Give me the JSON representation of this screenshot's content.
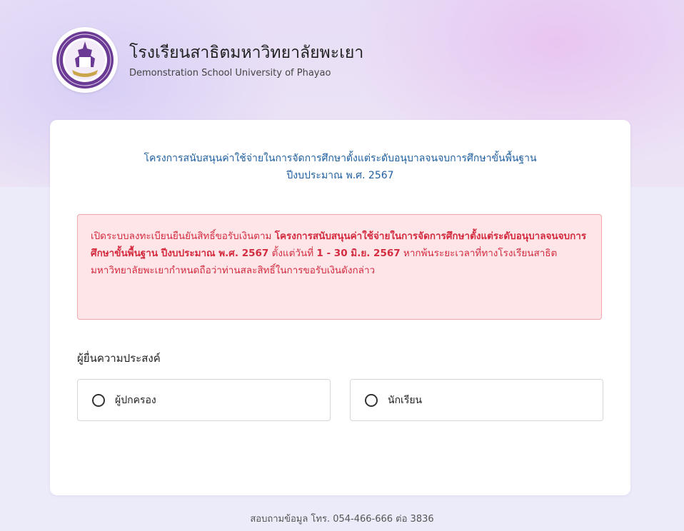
{
  "header": {
    "school_name_th": "โรงเรียนสาธิตมหาวิทยาลัยพะเยา",
    "school_name_en": "Demonstration School University of Phayao",
    "logo_icon": "school-emblem-icon"
  },
  "card": {
    "project_title_line1": "โครงการสนับสนุนค่าใช้จ่ายในการจัดการศึกษาตั้งแต่ระดับอนุบาลจนจบการศึกษาขั้นพื้นฐาน",
    "project_title_line2": "ปีงบประมาณ พ.ศ. 2567",
    "notice": {
      "intro": "เปิดระบบลงทะเบียนยืนยันสิทธิ์ขอรับเงินตาม ",
      "project_name": "โครงการสนับสนุนค่าใช้จ่ายในการจัดการศึกษาตั้งแต่ระดับอนุบาลจนจบการศึกษาขั้นพื้นฐาน ปีงบประมาณ พ.ศ. 2567",
      "date_prefix": "  ตั้งแต่วันที่ ",
      "date_range": "1 - 30 มิ.ย. 2567",
      "outro": " หากพ้นระยะเวลาที่ทางโรงเรียนสาธิตมหาวิทยาลัยพะเยากำหนดถือว่าท่านสละสิทธิ์ในการขอรับเงินดังกล่าว"
    },
    "applicant_label": "ผู้ยื่นความประสงค์",
    "options": [
      {
        "label": "ผู้ปกครอง",
        "selected": false
      },
      {
        "label": "นักเรียน",
        "selected": false
      }
    ]
  },
  "footer": {
    "contact": "สอบถามข้อมูล โทร. 054-466-666 ต่อ 3836"
  },
  "colors": {
    "title_blue": "#1f5fa0",
    "notice_red": "#d42b3f",
    "notice_bg": "#fde5e8",
    "notice_border": "#f1a7b0",
    "logo_purple": "#6b3a94"
  }
}
